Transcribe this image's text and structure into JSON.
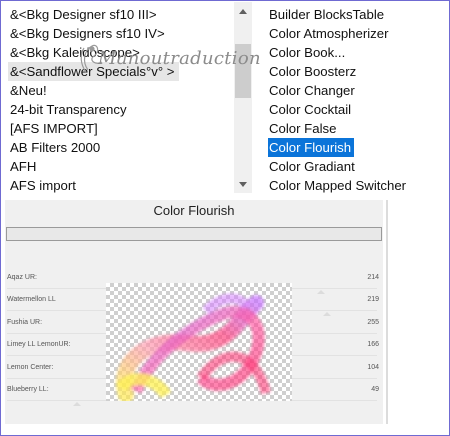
{
  "categories": {
    "items": [
      "&<Bkg Designer sf10 III>",
      "&<Bkg Designers sf10 IV>",
      "&<Bkg Kaleidoscope>",
      "&<Sandflower Specials°v° >",
      "&Neu!",
      "24-bit Transparency",
      "[AFS IMPORT]",
      "AB Filters 2000",
      "AFH",
      "AFS import"
    ],
    "selected_index": 3
  },
  "filters": {
    "items": [
      "Builder BlocksTable",
      "Color Atmospherizer",
      "Color Book...",
      "Color Boosterz",
      "Color Changer",
      "Color Cocktail",
      "Color False",
      "Color Flourish",
      "Color Gradiant",
      "Color Mapped Switcher"
    ],
    "selected_index": 7
  },
  "panel": {
    "title": "Color Flourish",
    "watermark": "Manoutraduction"
  },
  "params": [
    {
      "label": "Aqaz UR:",
      "value": "214"
    },
    {
      "label": "Watermellon LL",
      "value": "219"
    },
    {
      "label": "Fushia UR:",
      "value": "255"
    },
    {
      "label": "Limey LL LemonUR:",
      "value": "166"
    },
    {
      "label": "Lemon Center:",
      "value": "104"
    },
    {
      "label": "Blueberry LL:",
      "value": "49"
    }
  ],
  "colors": {
    "selection": "#0b74d9",
    "panel_bg": "#f0f0f0",
    "frame": "#6f6ad2"
  },
  "icons": {
    "scroll_up": "triangle-up",
    "scroll_down": "triangle-down"
  }
}
